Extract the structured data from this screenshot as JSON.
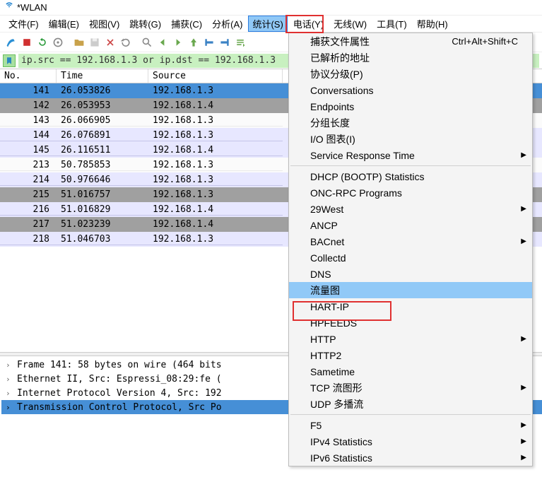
{
  "title": "*WLAN",
  "menubar": [
    "文件(F)",
    "编辑(E)",
    "视图(V)",
    "跳转(G)",
    "捕获(C)",
    "分析(A)",
    "统计(S)",
    "电话(Y)",
    "无线(W)",
    "工具(T)",
    "帮助(H)"
  ],
  "open_menu_index": 6,
  "filter": "ip.src == 192.168.1.3 or ip.dst == 192.168.1.3",
  "columns": {
    "no": "No.",
    "time": "Time",
    "source": "Source"
  },
  "packets": [
    {
      "no": 141,
      "time": "26.053826",
      "source": "192.168.1.3",
      "style": "sel"
    },
    {
      "no": 142,
      "time": "26.053953",
      "source": "192.168.1.4",
      "style": "bg1"
    },
    {
      "no": 143,
      "time": "26.066905",
      "source": "192.168.1.3",
      "style": "bg2"
    },
    {
      "no": 144,
      "time": "26.076891",
      "source": "192.168.1.3",
      "style": "bg0"
    },
    {
      "no": 145,
      "time": "26.116511",
      "source": "192.168.1.4",
      "style": "bg0"
    },
    {
      "no": 213,
      "time": "50.785853",
      "source": "192.168.1.3",
      "style": "bg2"
    },
    {
      "no": 214,
      "time": "50.976646",
      "source": "192.168.1.3",
      "style": "bg0"
    },
    {
      "no": 215,
      "time": "51.016757",
      "source": "192.168.1.3",
      "style": "bg1"
    },
    {
      "no": 216,
      "time": "51.016829",
      "source": "192.168.1.4",
      "style": "bg0"
    },
    {
      "no": 217,
      "time": "51.023239",
      "source": "192.168.1.4",
      "style": "bg1"
    },
    {
      "no": 218,
      "time": "51.046703",
      "source": "192.168.1.3",
      "style": "bg0"
    }
  ],
  "details": [
    {
      "text": "Frame 141: 58 bytes on wire (464 bits",
      "sel": false
    },
    {
      "text": "Ethernet II, Src: Espressi_08:29:fe (",
      "sel": false
    },
    {
      "text": "Internet Protocol Version 4, Src: 192",
      "sel": false
    },
    {
      "text": "Transmission Control Protocol, Src Po",
      "sel": true
    }
  ],
  "menu_items": [
    {
      "label": "捕获文件属性",
      "shortcut": "Ctrl+Alt+Shift+C"
    },
    {
      "label": "已解析的地址"
    },
    {
      "label": "协议分级(P)"
    },
    {
      "label": "Conversations"
    },
    {
      "label": "Endpoints"
    },
    {
      "label": "分组长度"
    },
    {
      "label": "I/O 图表(I)"
    },
    {
      "label": "Service Response Time",
      "sub": true
    },
    {
      "sep": true
    },
    {
      "label": "DHCP (BOOTP) Statistics"
    },
    {
      "label": "ONC-RPC Programs"
    },
    {
      "label": "29West",
      "sub": true
    },
    {
      "label": "ANCP"
    },
    {
      "label": "BACnet",
      "sub": true
    },
    {
      "label": "Collectd"
    },
    {
      "label": "DNS"
    },
    {
      "label": "流量图",
      "hl": true
    },
    {
      "label": "HART-IP"
    },
    {
      "label": "HPFEEDS"
    },
    {
      "label": "HTTP",
      "sub": true
    },
    {
      "label": "HTTP2"
    },
    {
      "label": "Sametime"
    },
    {
      "label": "TCP 流图形",
      "sub": true
    },
    {
      "label": "UDP 多播流"
    },
    {
      "sep": true
    },
    {
      "label": "F5",
      "sub": true
    },
    {
      "label": "IPv4 Statistics",
      "sub": true
    },
    {
      "label": "IPv6 Statistics",
      "sub": true
    }
  ]
}
